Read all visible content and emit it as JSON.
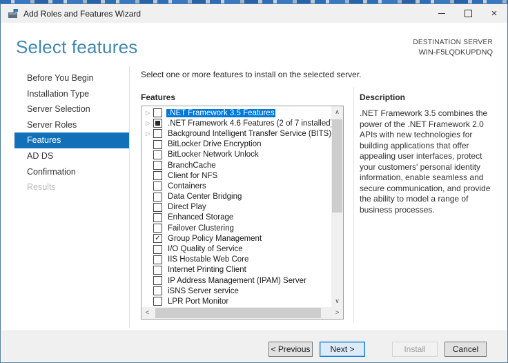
{
  "window": {
    "title": "Add Roles and Features Wizard"
  },
  "header": {
    "title": "Select features",
    "destination_label": "DESTINATION SERVER",
    "destination_server": "WIN-F5LQDKUPDNQ"
  },
  "sidebar": {
    "items": [
      {
        "label": "Before You Begin",
        "state": "normal"
      },
      {
        "label": "Installation Type",
        "state": "normal"
      },
      {
        "label": "Server Selection",
        "state": "normal"
      },
      {
        "label": "Server Roles",
        "state": "normal"
      },
      {
        "label": "Features",
        "state": "selected"
      },
      {
        "label": "AD DS",
        "state": "normal"
      },
      {
        "label": "Confirmation",
        "state": "normal"
      },
      {
        "label": "Results",
        "state": "disabled"
      }
    ]
  },
  "main": {
    "instruction": "Select one or more features to install on the selected server.",
    "list_label": "Features",
    "features": [
      {
        "label": ".NET Framework 3.5 Features",
        "checkbox": "unchecked",
        "expander": true,
        "selected": true
      },
      {
        "label": ".NET Framework 4.6 Features (2 of 7 installed)",
        "checkbox": "indeterminate",
        "expander": true,
        "selected": false
      },
      {
        "label": "Background Intelligent Transfer Service (BITS)",
        "checkbox": "unchecked",
        "expander": true,
        "selected": false
      },
      {
        "label": "BitLocker Drive Encryption",
        "checkbox": "unchecked",
        "expander": false,
        "selected": false
      },
      {
        "label": "BitLocker Network Unlock",
        "checkbox": "unchecked",
        "expander": false,
        "selected": false
      },
      {
        "label": "BranchCache",
        "checkbox": "unchecked",
        "expander": false,
        "selected": false
      },
      {
        "label": "Client for NFS",
        "checkbox": "unchecked",
        "expander": false,
        "selected": false
      },
      {
        "label": "Containers",
        "checkbox": "unchecked",
        "expander": false,
        "selected": false
      },
      {
        "label": "Data Center Bridging",
        "checkbox": "unchecked",
        "expander": false,
        "selected": false
      },
      {
        "label": "Direct Play",
        "checkbox": "unchecked",
        "expander": false,
        "selected": false
      },
      {
        "label": "Enhanced Storage",
        "checkbox": "unchecked",
        "expander": false,
        "selected": false
      },
      {
        "label": "Failover Clustering",
        "checkbox": "unchecked",
        "expander": false,
        "selected": false
      },
      {
        "label": "Group Policy Management",
        "checkbox": "checked",
        "expander": false,
        "selected": false
      },
      {
        "label": "I/O Quality of Service",
        "checkbox": "unchecked",
        "expander": false,
        "selected": false
      },
      {
        "label": "IIS Hostable Web Core",
        "checkbox": "unchecked",
        "expander": false,
        "selected": false
      },
      {
        "label": "Internet Printing Client",
        "checkbox": "unchecked",
        "expander": false,
        "selected": false
      },
      {
        "label": "IP Address Management (IPAM) Server",
        "checkbox": "unchecked",
        "expander": false,
        "selected": false
      },
      {
        "label": "iSNS Server service",
        "checkbox": "unchecked",
        "expander": false,
        "selected": false
      },
      {
        "label": "LPR Port Monitor",
        "checkbox": "unchecked",
        "expander": false,
        "selected": false
      }
    ]
  },
  "description_panel": {
    "title": "Description",
    "body": ".NET Framework 3.5 combines the power of the .NET Framework 2.0 APIs with new technologies for building applications that offer appealing user interfaces, protect your customers' personal identity information, enable seamless and secure communication, and provide the ability to model a range of business processes."
  },
  "footer": {
    "buttons": [
      {
        "label": "< Previous",
        "state": "normal"
      },
      {
        "label": "Next >",
        "state": "default"
      },
      {
        "label": "Install",
        "state": "disabled"
      },
      {
        "label": "Cancel",
        "state": "normal"
      }
    ]
  },
  "icons": {
    "expander": "▷",
    "check": "✓",
    "scroll_up": "∧",
    "scroll_down": "∨",
    "scroll_left": "<",
    "scroll_right": ">"
  },
  "colors": {
    "accent_blue": "#0078d7",
    "nav_selected": "#1170b8",
    "heading_blue": "#4188ae",
    "window_border": "#4f7d9e"
  }
}
